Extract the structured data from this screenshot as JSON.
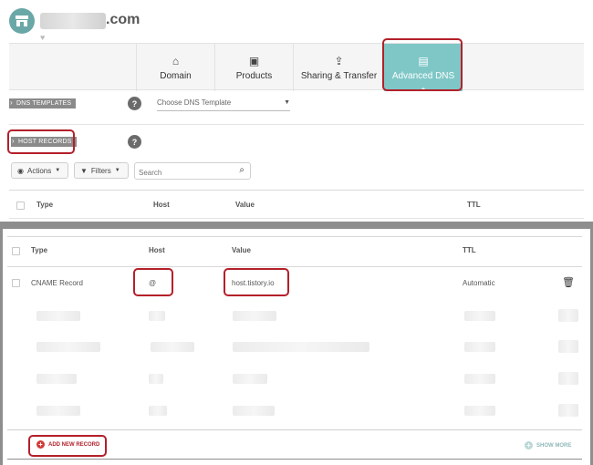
{
  "header": {
    "domain_suffix": ".com",
    "store_icon": "store-icon",
    "heart_icon": "heart-icon"
  },
  "tabs": [
    {
      "label": "Domain",
      "icon": "home-icon",
      "glyph": "⌂"
    },
    {
      "label": "Products",
      "icon": "box-icon",
      "glyph": "▣"
    },
    {
      "label": "Sharing & Transfer",
      "icon": "share-icon",
      "glyph": "⇪"
    },
    {
      "label": "Advanced DNS",
      "icon": "server-icon",
      "glyph": "▤",
      "active": true
    }
  ],
  "dns_templates": {
    "label": "DNS TEMPLATES",
    "help": "?",
    "select_value": "Choose DNS Template"
  },
  "host_records": {
    "label": "HOST RECORDS",
    "help": "?",
    "actions_label": "Actions",
    "filters_label": "Filters",
    "search_placeholder": "Search"
  },
  "table": {
    "headers": [
      "Type",
      "Host",
      "Value",
      "TTL"
    ],
    "record": {
      "type": "CNAME Record",
      "host": "@",
      "value": "host.tistory.io",
      "ttl": "Automatic"
    }
  },
  "footer": {
    "add_label": "ADD NEW RECORD",
    "show_more_label": "SHOW MORE"
  },
  "colors": {
    "accent": "#7fc7c7",
    "highlight": "#b3202a"
  }
}
